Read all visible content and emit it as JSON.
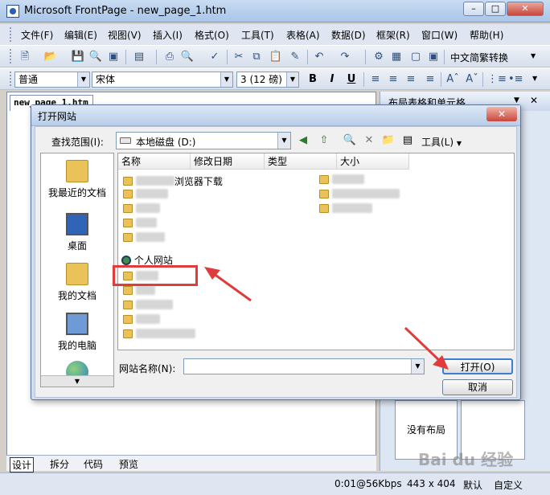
{
  "window": {
    "title": "Microsoft FrontPage - new_page_1.htm",
    "min": "0",
    "max": "1",
    "close": "r"
  },
  "menubar": [
    "文件(F)",
    "编辑(E)",
    "视图(V)",
    "插入(I)",
    "格式(O)",
    "工具(T)",
    "表格(A)",
    "数据(D)",
    "框架(R)",
    "窗口(W)",
    "帮助(H)"
  ],
  "toolbar1": {
    "convert_label": "中文简繁转换"
  },
  "toolbar2": {
    "style": "普通",
    "font": "宋体",
    "size": "3 (12 磅)",
    "bold": "B",
    "italic": "I",
    "underline": "U"
  },
  "editor": {
    "doc_tab": "new_page_1.htm"
  },
  "taskpane": {
    "title": "布局表格和单元格",
    "no_layout": "没有布局"
  },
  "view_tabs": [
    "设计",
    "拆分",
    "代码",
    "预览"
  ],
  "status": {
    "speed": "0:01@56Kbps",
    "dimensions": "443 x 404",
    "mode": "默认",
    "custom": "自定义"
  },
  "dialog": {
    "title": "打开网站",
    "close": "x",
    "lookin_label": "查找范围(I):",
    "lookin_value": "本地磁盘 (D:)",
    "tools_label": "工具(L)",
    "places": [
      "我最近的文档",
      "桌面",
      "我的文档",
      "我的电脑"
    ],
    "columns": [
      "名称",
      "修改日期",
      "类型",
      "大小"
    ],
    "visible_file_fragments": {
      "browser_download": "浏览器下载",
      "highlighted_site": "个人网站"
    },
    "sitename_label": "网站名称(N):",
    "sitename_value": "",
    "open_button": "打开(O)",
    "cancel_button": "取消"
  },
  "watermark": "Bai du 经验",
  "colors": {
    "highlight": "#e03c3c",
    "title_gradient_top": "#c9dcf2",
    "accent_blue": "#3c7fd1"
  }
}
